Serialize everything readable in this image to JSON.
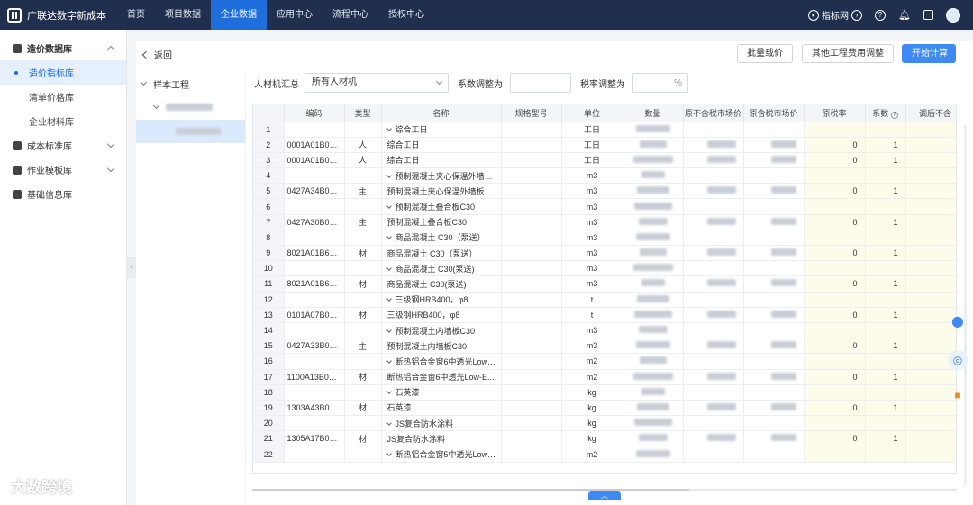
{
  "topbar": {
    "brand": "广联达数字新成本",
    "nav": [
      "首页",
      "项目数据",
      "企业数据",
      "应用中心",
      "流程中心",
      "授权中心"
    ],
    "active_nav": "企业数据",
    "index_link": "指标网",
    "icons": [
      "link-icon",
      "help-icon",
      "bell-icon",
      "window-icon",
      "avatar"
    ]
  },
  "sidebar": {
    "groups": [
      {
        "label": "造价数据库",
        "icon": "database-icon",
        "expanded": true,
        "items": [
          {
            "label": "造价指标库",
            "active": true
          },
          {
            "label": "清单价格库",
            "active": false
          },
          {
            "label": "企业材料库",
            "active": false
          }
        ]
      },
      {
        "label": "成本标准库",
        "icon": "cube-icon",
        "expanded": false,
        "items": []
      },
      {
        "label": "作业模板库",
        "icon": "template-icon",
        "expanded": false,
        "items": []
      },
      {
        "label": "基础信息库",
        "icon": "db-icon",
        "expanded": false,
        "items": []
      }
    ]
  },
  "toolbar": {
    "back": "返回",
    "batch_price": "批量载价",
    "other_adjust": "其他工程费用调整",
    "start_calc": "开始计算"
  },
  "tree": {
    "root": "样本工程"
  },
  "filter": {
    "summary_label": "人材机汇总",
    "summary_value": "所有人材机",
    "coef_label": "系数调整为",
    "tax_label": "税率调整为",
    "tax_unit": "%"
  },
  "table": {
    "headers": [
      "",
      "编码",
      "类型",
      "名称",
      "规格型号",
      "单位",
      "数量",
      "原不含税市场价",
      "原含税市场价",
      "原税率",
      "系数",
      "调后不含"
    ],
    "rows": [
      {
        "idx": "1",
        "code": "",
        "type": "",
        "name": "综合工日",
        "parent": true,
        "unit": "工日",
        "tax": "",
        "coef": ""
      },
      {
        "idx": "2",
        "code": "0001A01B01BC",
        "type": "人",
        "name": "综合工日",
        "parent": false,
        "unit": "工日",
        "tax": "0",
        "coef": "1"
      },
      {
        "idx": "3",
        "code": "0001A01B01B...",
        "type": "人",
        "name": "综合工日",
        "parent": false,
        "unit": "工日",
        "tax": "0",
        "coef": "1"
      },
      {
        "idx": "4",
        "code": "",
        "type": "",
        "name": "预制混凝土夹心保温外墙板C30",
        "parent": true,
        "unit": "m3",
        "tax": "",
        "coef": ""
      },
      {
        "idx": "5",
        "code": "0427A34B01BV",
        "type": "主",
        "name": "预制混凝土夹心保温外墙板...",
        "parent": false,
        "unit": "m3",
        "tax": "0",
        "coef": "1"
      },
      {
        "idx": "6",
        "code": "",
        "type": "",
        "name": "预制混凝土叠合板C30",
        "parent": true,
        "unit": "m3",
        "tax": "",
        "coef": ""
      },
      {
        "idx": "7",
        "code": "0427A30B01BV",
        "type": "主",
        "name": "预制混凝土叠合板C30",
        "parent": false,
        "unit": "m3",
        "tax": "0",
        "coef": "1"
      },
      {
        "idx": "8",
        "code": "",
        "type": "",
        "name": "商品混凝土 C30（泵送）",
        "parent": true,
        "unit": "m3",
        "tax": "",
        "coef": ""
      },
      {
        "idx": "9",
        "code": "8021A01B63B...",
        "type": "材",
        "name": "商品混凝土 C30（泵送）",
        "parent": false,
        "unit": "m3",
        "tax": "0",
        "coef": "1"
      },
      {
        "idx": "10",
        "code": "",
        "type": "",
        "name": "商品混凝土 C30(泵送)",
        "parent": true,
        "unit": "m3",
        "tax": "",
        "coef": ""
      },
      {
        "idx": "11",
        "code": "8021A01B63B...",
        "type": "材",
        "name": "商品混凝土 C30(泵送)",
        "parent": false,
        "unit": "m3",
        "tax": "0",
        "coef": "1"
      },
      {
        "idx": "12",
        "code": "",
        "type": "",
        "name": "三级钢HRB400，φ8",
        "parent": true,
        "unit": "t",
        "tax": "",
        "coef": ""
      },
      {
        "idx": "13",
        "code": "0101A07B03C...",
        "type": "材",
        "name": "三级钢HRB400，φ8",
        "parent": false,
        "unit": "t",
        "tax": "0",
        "coef": "1"
      },
      {
        "idx": "14",
        "code": "",
        "type": "",
        "name": "预制混凝土内墙板C30",
        "parent": true,
        "unit": "m3",
        "tax": "",
        "coef": ""
      },
      {
        "idx": "15",
        "code": "0427A33B01BV",
        "type": "主",
        "name": "预制混凝土内墙板C30",
        "parent": false,
        "unit": "m3",
        "tax": "0",
        "coef": "1"
      },
      {
        "idx": "16",
        "code": "",
        "type": "",
        "name": "断热铝合金窗6中透光Low-E+...",
        "parent": true,
        "unit": "m2",
        "tax": "",
        "coef": ""
      },
      {
        "idx": "17",
        "code": "1100A13B01B...",
        "type": "材",
        "name": "断热铝合金窗6中透光Low-E...",
        "parent": false,
        "unit": "m2",
        "tax": "0",
        "coef": "1"
      },
      {
        "idx": "18",
        "code": "",
        "type": "",
        "name": "石英漆",
        "parent": true,
        "unit": "kg",
        "tax": "",
        "coef": ""
      },
      {
        "idx": "19",
        "code": "1303A43B01CB",
        "type": "材",
        "name": "石英漆",
        "parent": false,
        "unit": "kg",
        "tax": "0",
        "coef": "1"
      },
      {
        "idx": "20",
        "code": "",
        "type": "",
        "name": "JS复合防水涂料",
        "parent": true,
        "unit": "kg",
        "tax": "",
        "coef": ""
      },
      {
        "idx": "21",
        "code": "1305A17B01CB",
        "type": "材",
        "name": "JS复合防水涂料",
        "parent": false,
        "unit": "kg",
        "tax": "0",
        "coef": "1"
      },
      {
        "idx": "22",
        "code": "",
        "type": "",
        "name": "断热铝合金窗5中透光Low-E+...",
        "parent": true,
        "unit": "m2",
        "tax": "",
        "coef": ""
      }
    ]
  },
  "watermark": "大数跨境"
}
